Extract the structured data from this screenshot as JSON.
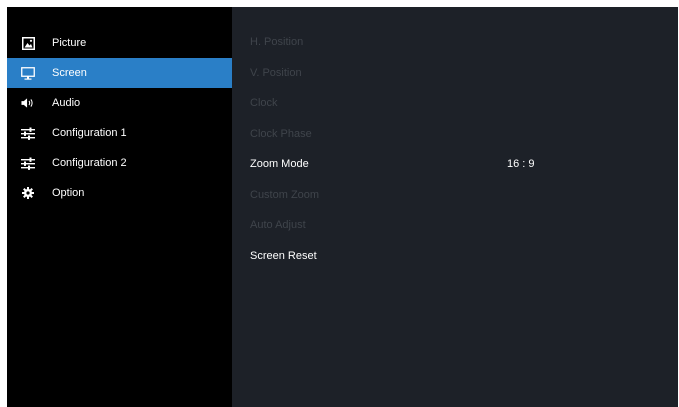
{
  "menu": {
    "items": [
      {
        "label": "Picture",
        "icon": "picture-icon"
      },
      {
        "label": "Screen",
        "icon": "monitor-icon",
        "active": true
      },
      {
        "label": "Audio",
        "icon": "speaker-icon"
      },
      {
        "label": "Configuration 1",
        "icon": "sliders-icon"
      },
      {
        "label": "Configuration 2",
        "icon": "sliders-icon"
      },
      {
        "label": "Option",
        "icon": "gear-icon"
      }
    ]
  },
  "screen_settings": {
    "rows": [
      {
        "label": "H. Position",
        "value": "",
        "enabled": false
      },
      {
        "label": "V. Position",
        "value": "",
        "enabled": false
      },
      {
        "label": "Clock",
        "value": "",
        "enabled": false
      },
      {
        "label": "Clock Phase",
        "value": "",
        "enabled": false
      },
      {
        "label": "Zoom Mode",
        "value": "16 : 9",
        "enabled": true
      },
      {
        "label": "Custom Zoom",
        "value": "",
        "enabled": false
      },
      {
        "label": "Auto Adjust",
        "value": "",
        "enabled": false
      },
      {
        "label": "Screen Reset",
        "value": "",
        "enabled": true
      }
    ]
  },
  "colors": {
    "accent": "#2a7fc7",
    "panel": "#1d2128",
    "sidebar": "#000000",
    "disabled_text": "#3f444b",
    "text": "#ffffff"
  }
}
